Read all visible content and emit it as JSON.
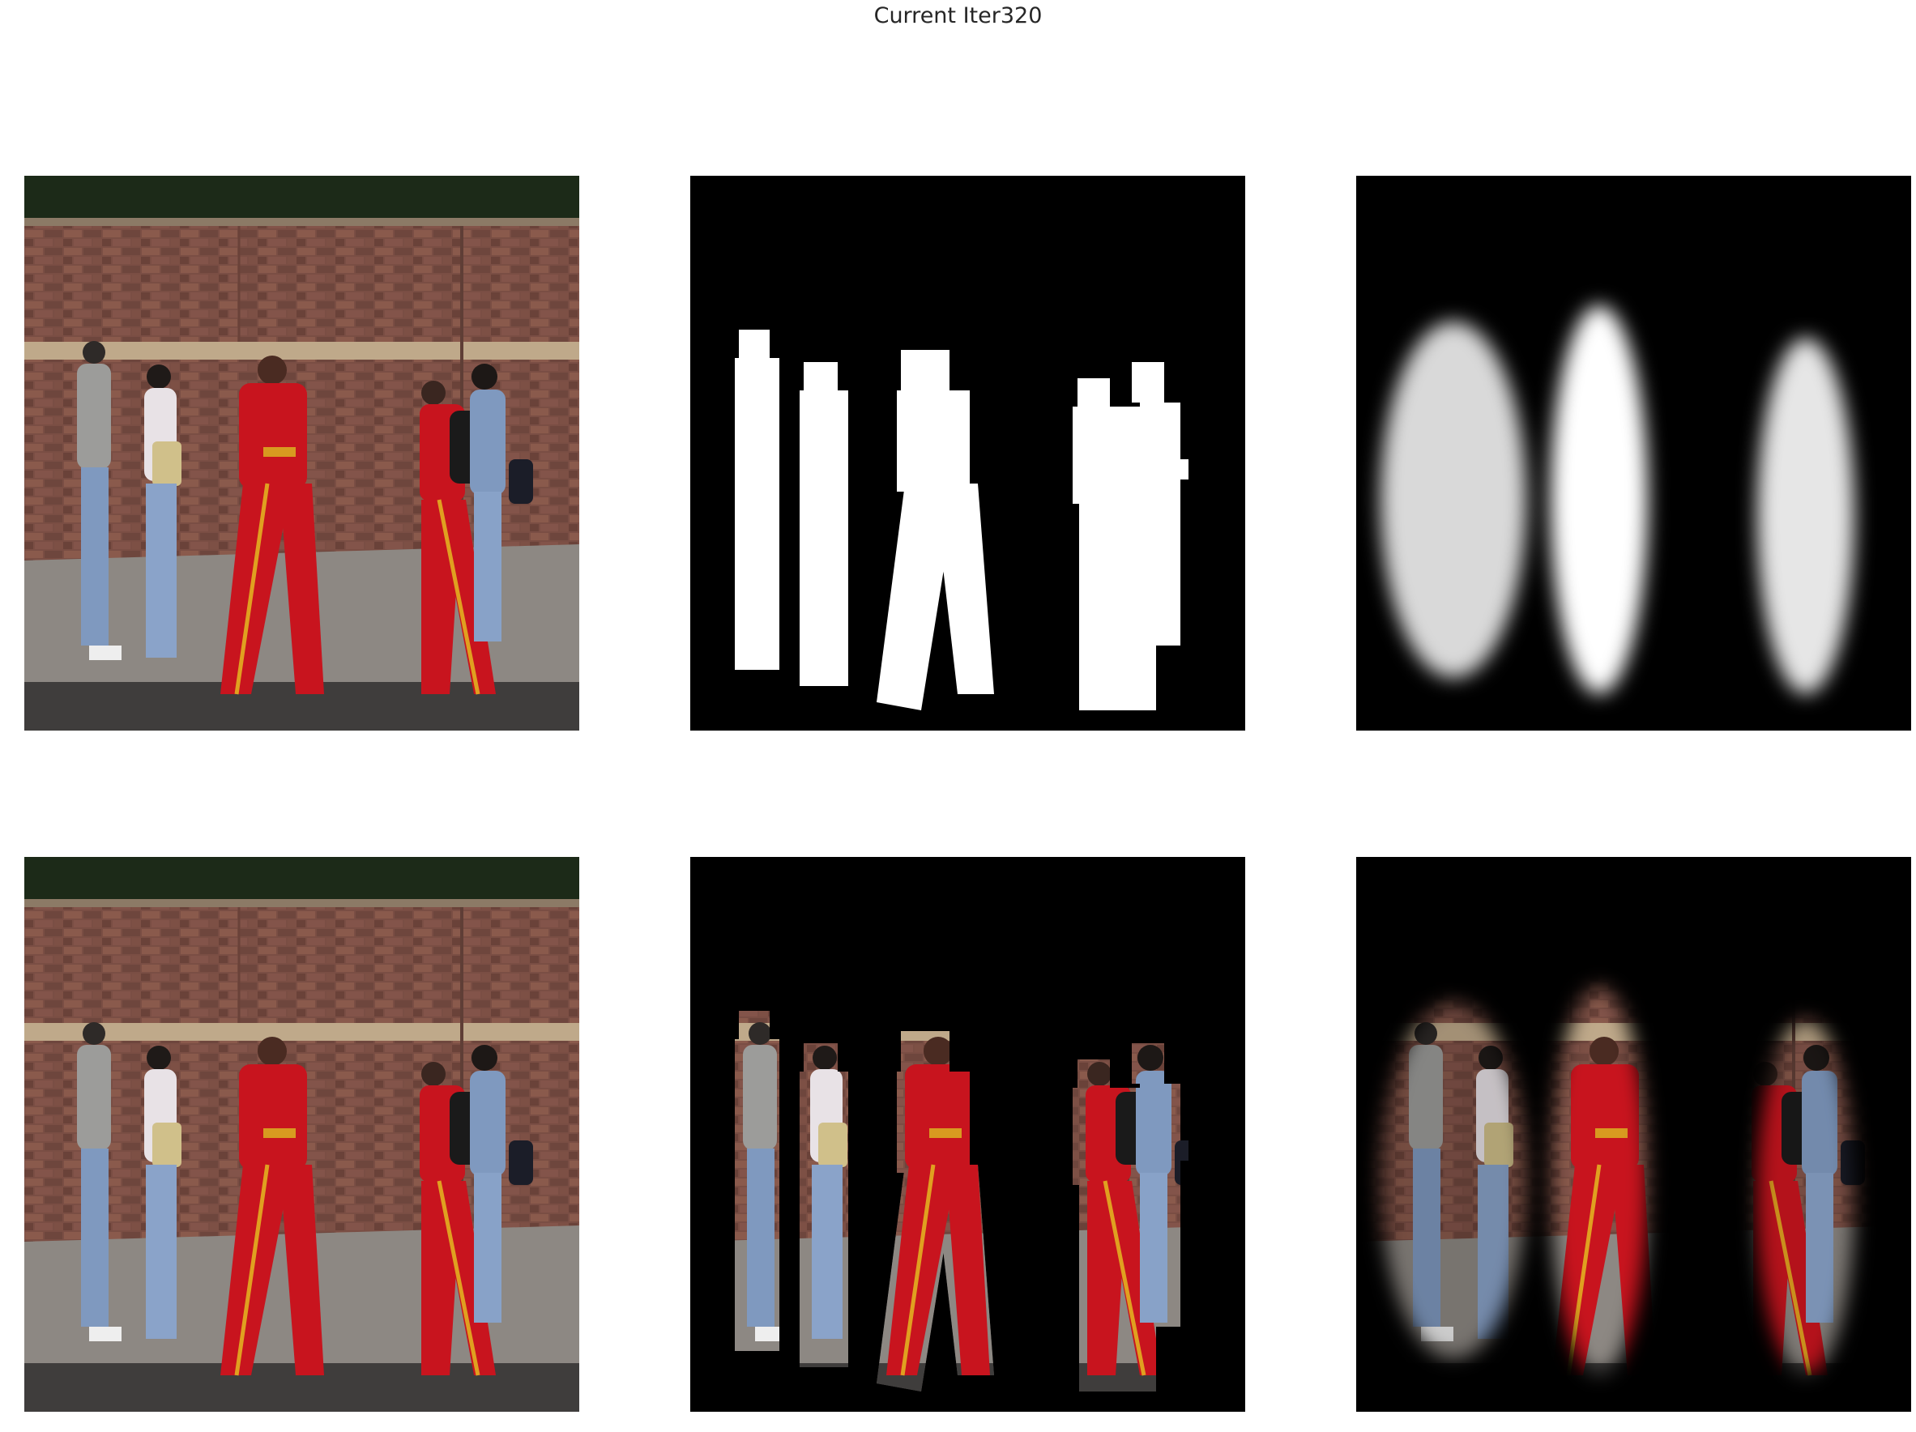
{
  "figure": {
    "title": "Current Iter320"
  },
  "panels": [
    {
      "name": "input-image",
      "content": "photo"
    },
    {
      "name": "ground-truth-mask",
      "content": "binary-mask"
    },
    {
      "name": "predicted-mask",
      "content": "soft-mask"
    },
    {
      "name": "input-image-copy",
      "content": "photo"
    },
    {
      "name": "ground-truth-masked-image",
      "content": "masked-photo"
    },
    {
      "name": "predicted-masked-image",
      "content": "soft-masked-photo"
    }
  ],
  "colors": {
    "title_text": "#262626",
    "background": "#ffffff",
    "mask_background": "#000000",
    "mask_foreground": "#ffffff",
    "brick": "#7a4e44",
    "suit_red": "#c8141e",
    "jeans_blue": "#7f99bf"
  }
}
